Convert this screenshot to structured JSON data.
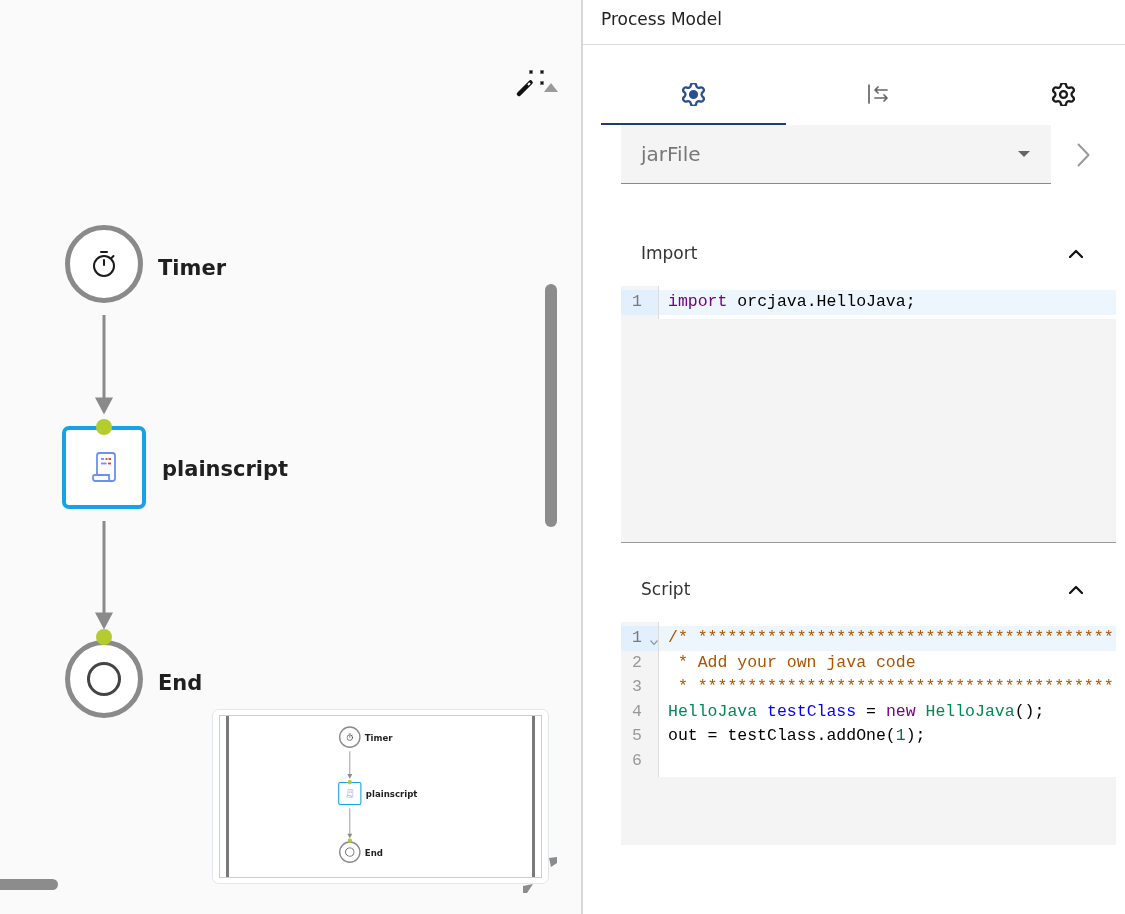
{
  "canvas": {
    "nodes": [
      {
        "kind": "timer",
        "label": "Timer",
        "selected": false
      },
      {
        "kind": "script",
        "label": "plainscript",
        "selected": true
      },
      {
        "kind": "end",
        "label": "End",
        "selected": false
      }
    ],
    "minimap": {
      "nodes": [
        {
          "kind": "timer",
          "label": "Timer",
          "selected": false
        },
        {
          "kind": "script",
          "label": "plainscript",
          "selected": true
        },
        {
          "kind": "end",
          "label": "End",
          "selected": false
        }
      ]
    }
  },
  "panel": {
    "title": "Process Model",
    "tabs": [
      {
        "kind": "cog",
        "selected": true
      },
      {
        "kind": "swap",
        "selected": false
      },
      {
        "kind": "gear",
        "selected": false
      }
    ],
    "select": {
      "value": "jarFile"
    },
    "sections": [
      {
        "title": "Import",
        "expanded": true,
        "lines": [
          {
            "number": "1",
            "active": true,
            "foldable": false,
            "tokens": [
              {
                "kind": "keyword",
                "text": "import"
              },
              {
                "kind": "plain",
                "text": " orcjava.HelloJava;"
              }
            ]
          }
        ]
      },
      {
        "title": "Script",
        "expanded": true,
        "lines": [
          {
            "number": "1",
            "active": true,
            "foldable": true,
            "tokens": [
              {
                "kind": "comment",
                "text": "/* ******************************************"
              }
            ]
          },
          {
            "number": "2",
            "active": false,
            "foldable": false,
            "tokens": [
              {
                "kind": "comment",
                "text": " * Add your own java code"
              }
            ]
          },
          {
            "number": "3",
            "active": false,
            "foldable": false,
            "tokens": [
              {
                "kind": "comment",
                "text": " * ******************************************"
              }
            ]
          },
          {
            "number": "4",
            "active": false,
            "foldable": false,
            "tokens": [
              {
                "kind": "type",
                "text": "HelloJava"
              },
              {
                "kind": "def",
                "text": " testClass"
              },
              {
                "kind": "plain",
                "text": " = "
              },
              {
                "kind": "keyword",
                "text": "new"
              },
              {
                "kind": "type",
                "text": " HelloJava"
              },
              {
                "kind": "plain",
                "text": "();"
              }
            ]
          },
          {
            "number": "5",
            "active": false,
            "foldable": false,
            "tokens": [
              {
                "kind": "plain",
                "text": "out = testClass.addOne("
              },
              {
                "kind": "number",
                "text": "1"
              },
              {
                "kind": "plain",
                "text": ");"
              }
            ]
          },
          {
            "number": "6",
            "active": false,
            "foldable": false
          }
        ]
      }
    ]
  }
}
